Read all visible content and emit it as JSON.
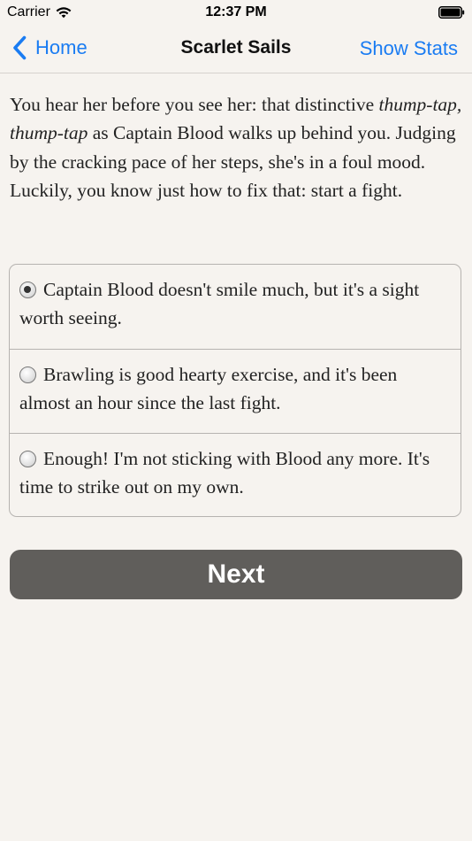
{
  "status_bar": {
    "carrier": "Carrier",
    "time": "12:37 PM"
  },
  "nav": {
    "back_label": "Home",
    "title": "Scarlet Sails",
    "right_label": "Show Stats"
  },
  "story": {
    "part1": "You hear her before you see her: that distinctive ",
    "italic": "thump-tap, thump-tap",
    "part2": " as Captain Blood walks up behind you. Judging by the cracking pace of her steps, she's in a foul mood. Luckily, you know just how to fix that: start a fight."
  },
  "choices": [
    {
      "label": "Captain Blood doesn't smile much, but it's a sight worth seeing.",
      "selected": true
    },
    {
      "label": "Brawling is good hearty exercise, and it's been almost an hour since the last fight.",
      "selected": false
    },
    {
      "label": "Enough! I'm not sticking with Blood any more. It's time to strike out on my own.",
      "selected": false
    }
  ],
  "next_label": "Next",
  "colors": {
    "accent": "#1a7cf2",
    "background": "#f6f3ef",
    "button": "#605e5b"
  },
  "icons": {
    "wifi": "wifi-icon",
    "battery": "battery-icon",
    "back": "chevron-left-icon",
    "radio_selected": "radio-selected-icon",
    "radio_unselected": "radio-unselected-icon"
  }
}
